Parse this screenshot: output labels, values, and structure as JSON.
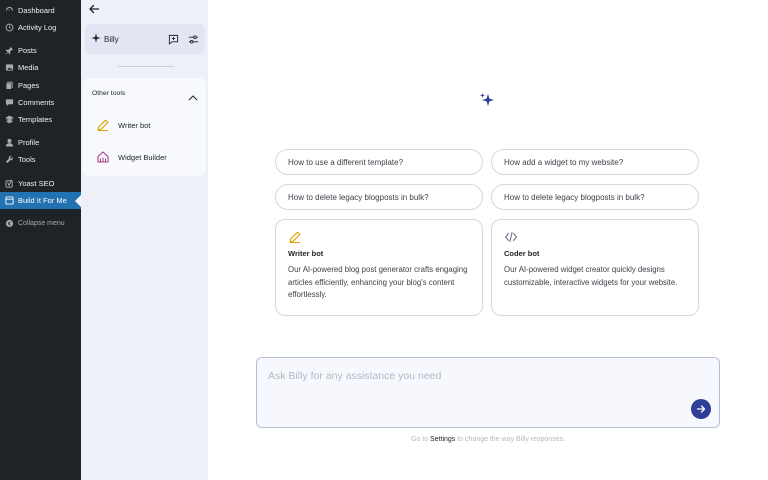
{
  "wp_menu": {
    "items": [
      {
        "label": "Dashboard",
        "icon": "dashboard-icon"
      },
      {
        "label": "Activity Log",
        "icon": "history-icon"
      },
      {
        "label": "Posts",
        "icon": "pin-icon"
      },
      {
        "label": "Media",
        "icon": "media-icon"
      },
      {
        "label": "Pages",
        "icon": "pages-icon"
      },
      {
        "label": "Comments",
        "icon": "comment-icon"
      },
      {
        "label": "Templates",
        "icon": "templates-icon"
      },
      {
        "label": "Profile",
        "icon": "user-icon"
      },
      {
        "label": "Tools",
        "icon": "wrench-icon"
      },
      {
        "label": "Yoast SEO",
        "icon": "yoast-icon"
      },
      {
        "label": "Build It For Me",
        "icon": "build-icon"
      },
      {
        "label": "Collapse menu",
        "icon": "collapse-icon"
      }
    ],
    "active": "Build It For Me",
    "accent": "#2271b1"
  },
  "panel": {
    "title": "Billy",
    "other_tools_label": "Other tools",
    "tools": [
      {
        "label": "Writer bot",
        "icon": "pencil-icon",
        "color": "#e0a100"
      },
      {
        "label": "Widget Builder",
        "icon": "widget-icon",
        "color": "#a23c8c"
      }
    ]
  },
  "main": {
    "suggestions": [
      "How to use a different template?",
      "How add a widget to my website?",
      "How to delete legacy blogposts in bulk?",
      "How to delete legacy blogposts in bulk?"
    ],
    "cards": [
      {
        "title": "Writer bot",
        "description": "Our AI-powered blog post generator crafts engaging articles efficiently, enhancing your blog's content effortlessly.",
        "icon": "pencil-icon"
      },
      {
        "title": "Coder bot",
        "description": "Our AI-powered widget creator quickly designs customizable, interactive widgets for your website.",
        "icon": "code-icon"
      }
    ],
    "input_placeholder": "Ask Billy for any assistance you need",
    "footer_prefix": "Go to ",
    "footer_link": "Settings",
    "footer_suffix": " to change the way Billy responses.",
    "brand_color": "#2f3f98"
  }
}
